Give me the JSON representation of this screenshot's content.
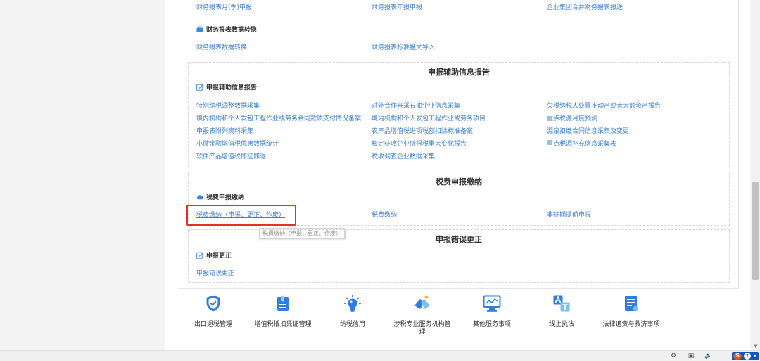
{
  "top_links": {
    "l1": "财务报表月(季)申报",
    "l2": "财务报表年报申报",
    "l3": "企业集团合并财务报表报送"
  },
  "fs_convert": {
    "heading": "财务报表数据转换",
    "links": [
      "财务报表数据转换",
      "财务报表标准报文导入"
    ]
  },
  "aux_report": {
    "title": "申报辅助信息报告",
    "heading": "申报辅助信息报告",
    "links": [
      "特别纳税调整数据采集",
      "对外合作开采石油企业信息采集",
      "欠税纳税人处置不动产或者大额资产报告",
      "境内机构和个人发包工程作业或劳务合同款项支付情况备案",
      "境内机构和个人发包工程作业或劳务项目",
      "重点税源月度预测",
      "申报表附列资料采集",
      "农产品增值税进项税额扣除标准备案",
      "源泉扣缴合同信息采集及变更",
      "小微金融增值税优惠数据统计",
      "核定征收企业所得税重大变化报告",
      "重点税源补充信息采集表",
      "软件产品增值税即征即退",
      "税收调查企业数据采集"
    ]
  },
  "tax_pay": {
    "title": "税费申报缴纳",
    "heading": "税费申报缴纳",
    "links": [
      "税费缴纳（申报、更正、作废）",
      "税费缴纳",
      "非征期提前申报"
    ],
    "tooltip": "税费缴纳（申报、更正、作废）"
  },
  "correction": {
    "title": "申报错误更正",
    "heading": "申报更正",
    "links": [
      "申报错误更正"
    ]
  },
  "toolbar": {
    "items": [
      {
        "label": "出口退税管理",
        "icon": "shield-check-icon"
      },
      {
        "label": "增值税抵扣凭证管理",
        "icon": "document-clip-icon"
      },
      {
        "label": "纳税信用",
        "icon": "lightbulb-icon"
      },
      {
        "label": "涉税专业服务机构管理",
        "icon": "handshake-icon"
      },
      {
        "label": "其他服务事项",
        "icon": "monitor-icon"
      },
      {
        "label": "线上执法",
        "icon": "translate-icon"
      },
      {
        "label": "法律追责与救济事项",
        "icon": "clipboard-list-icon"
      }
    ]
  },
  "colors": {
    "link": "#3d7fd1",
    "accent": "#2f7de1",
    "highlight_border": "#e1312a"
  },
  "tray": {
    "sogou_letter": "S",
    "help_glyph": "?"
  }
}
